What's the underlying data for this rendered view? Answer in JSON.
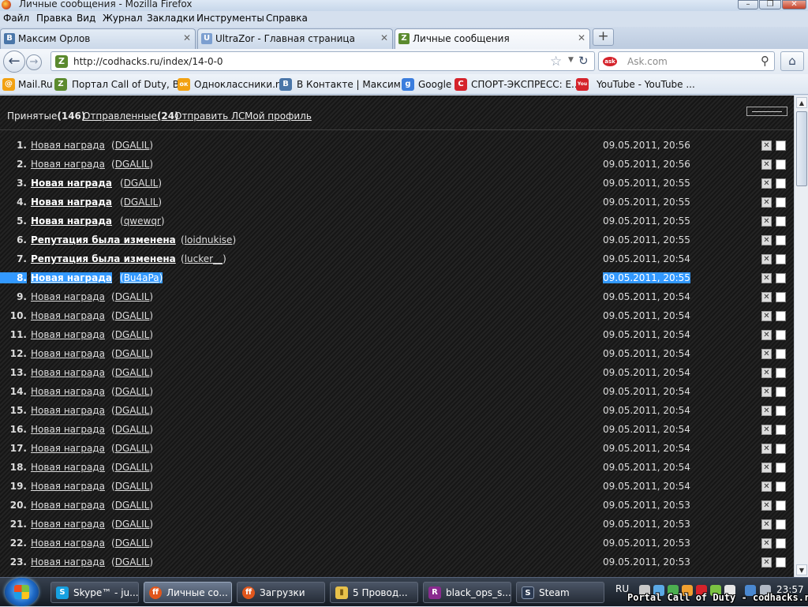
{
  "window": {
    "title": "Личные сообщения - Mozilla Firefox",
    "minimize": "–",
    "maximize": "❐",
    "close": "✕"
  },
  "menu": [
    "Файл",
    "Правка",
    "Вид",
    "Журнал",
    "Закладки",
    "Инструменты",
    "Справка"
  ],
  "tabs": [
    {
      "label": "Максим Орлов",
      "icon": "vk-icon",
      "icon_text": "В",
      "close": "✕"
    },
    {
      "label": "UltraZor - Главная страница",
      "icon": "ultrazor-icon",
      "icon_text": "U",
      "close": "✕"
    },
    {
      "label": "Личные сообщения",
      "icon": "codhacks-icon",
      "icon_text": "Z",
      "close": "✕"
    }
  ],
  "new_tab": "+",
  "nav": {
    "back": "←",
    "forward": "→",
    "url": "http://codhacks.ru/index/14-0-0",
    "site_icon_text": "Z",
    "star": "☆",
    "dropdown": "▼",
    "reload": "↻",
    "search_engine": "ask",
    "search_placeholder": "Ask.com",
    "search_icon": "⚲",
    "home": "⌂"
  },
  "bookmarks": [
    {
      "label": "Mail.Ru",
      "icon_text": "@",
      "color": "#f2a111"
    },
    {
      "label": "Портал Call of Duty, B...",
      "icon_text": "Z",
      "color": "#5b8a2e"
    },
    {
      "label": "Одноклассники.ru",
      "icon_text": "ок",
      "color": "#f2a111"
    },
    {
      "label": "В Контакте | Максим ...",
      "icon_text": "В",
      "color": "#4a76a8"
    },
    {
      "label": "Google",
      "icon_text": "g",
      "color": "#3b7ddd"
    },
    {
      "label": "СПОРТ-ЭКСПРЕСС: Е...",
      "icon_text": "С",
      "color": "#d5232b"
    },
    {
      "label": "YouTube - YouTube ...",
      "icon_text": "You",
      "color": "#d5232b"
    }
  ],
  "page": {
    "nav": {
      "received_label": "Принятые",
      "received_count": "(146)",
      "sent_label": "Отправленные",
      "sent_count": "(24)",
      "send": "Отправить ЛС",
      "profile": "Мой профиль"
    },
    "selected_row": 8,
    "messages": [
      {
        "num": "1.",
        "subject": "Новая награда",
        "from": "DGALIL",
        "date": "09.05.2011, 20:56",
        "unread": false
      },
      {
        "num": "2.",
        "subject": "Новая награда",
        "from": "DGALIL",
        "date": "09.05.2011, 20:56",
        "unread": false
      },
      {
        "num": "3.",
        "subject": "Новая награда",
        "from": "DGALIL",
        "date": "09.05.2011, 20:55",
        "unread": true
      },
      {
        "num": "4.",
        "subject": "Новая награда",
        "from": "DGALIL",
        "date": "09.05.2011, 20:55",
        "unread": true
      },
      {
        "num": "5.",
        "subject": "Новая награда",
        "from": "qwewqr",
        "date": "09.05.2011, 20:55",
        "unread": true
      },
      {
        "num": "6.",
        "subject": "Репутация была изменена",
        "from": "loidnukise",
        "date": "09.05.2011, 20:55",
        "unread": true
      },
      {
        "num": "7.",
        "subject": "Репутация была изменена",
        "from": "lucker__",
        "date": "09.05.2011, 20:54",
        "unread": true
      },
      {
        "num": "8.",
        "subject": "Новая награда",
        "from": "Bu4aPa",
        "date": "09.05.2011, 20:55",
        "unread": true
      },
      {
        "num": "9.",
        "subject": "Новая награда",
        "from": "DGALIL",
        "date": "09.05.2011, 20:54",
        "unread": false
      },
      {
        "num": "10.",
        "subject": "Новая награда",
        "from": "DGALIL",
        "date": "09.05.2011, 20:54",
        "unread": false
      },
      {
        "num": "11.",
        "subject": "Новая награда",
        "from": "DGALIL",
        "date": "09.05.2011, 20:54",
        "unread": false
      },
      {
        "num": "12.",
        "subject": "Новая награда",
        "from": "DGALIL",
        "date": "09.05.2011, 20:54",
        "unread": false
      },
      {
        "num": "13.",
        "subject": "Новая награда",
        "from": "DGALIL",
        "date": "09.05.2011, 20:54",
        "unread": false
      },
      {
        "num": "14.",
        "subject": "Новая награда",
        "from": "DGALIL",
        "date": "09.05.2011, 20:54",
        "unread": false
      },
      {
        "num": "15.",
        "subject": "Новая награда",
        "from": "DGALIL",
        "date": "09.05.2011, 20:54",
        "unread": false
      },
      {
        "num": "16.",
        "subject": "Новая награда",
        "from": "DGALIL",
        "date": "09.05.2011, 20:54",
        "unread": false
      },
      {
        "num": "17.",
        "subject": "Новая награда",
        "from": "DGALIL",
        "date": "09.05.2011, 20:54",
        "unread": false
      },
      {
        "num": "18.",
        "subject": "Новая награда",
        "from": "DGALIL",
        "date": "09.05.2011, 20:54",
        "unread": false
      },
      {
        "num": "19.",
        "subject": "Новая награда",
        "from": "DGALIL",
        "date": "09.05.2011, 20:54",
        "unread": false
      },
      {
        "num": "20.",
        "subject": "Новая награда",
        "from": "DGALIL",
        "date": "09.05.2011, 20:53",
        "unread": false
      },
      {
        "num": "21.",
        "subject": "Новая награда",
        "from": "DGALIL",
        "date": "09.05.2011, 20:53",
        "unread": false
      },
      {
        "num": "22.",
        "subject": "Новая награда",
        "from": "DGALIL",
        "date": "09.05.2011, 20:53",
        "unread": false
      },
      {
        "num": "23.",
        "subject": "Новая награда",
        "from": "DGALIL",
        "date": "09.05.2011, 20:53",
        "unread": false
      }
    ],
    "delete_glyph": "✕"
  },
  "taskbar": {
    "items": [
      {
        "label": "Skype™ - ju...",
        "icon_text": "S",
        "color": "#16a0e0",
        "active": false
      },
      {
        "label": "Личные со...",
        "icon_text": "ff",
        "color": "#e0561c",
        "active": true
      },
      {
        "label": "Загрузки",
        "icon_text": "ff",
        "color": "#e0561c",
        "active": false
      },
      {
        "label": "5 Провод...",
        "icon_text": "▮",
        "color": "#e8c14a",
        "active": false
      },
      {
        "label": "black_ops_s...",
        "icon_text": "R",
        "color": "#8a2b8f",
        "active": false
      },
      {
        "label": "Steam",
        "icon_text": "S",
        "color": "#2b3950",
        "active": false
      }
    ],
    "lang": "RU",
    "clock": "23:57"
  },
  "watermark": "Portal Call of Duty - codhacks.ru"
}
